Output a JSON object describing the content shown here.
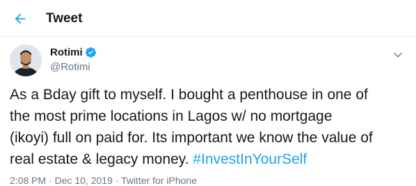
{
  "header": {
    "title": "Tweet",
    "back_icon": "arrow-left-icon"
  },
  "colors": {
    "accent": "#1da1f2",
    "text": "#14171a",
    "muted": "#657786",
    "divider": "#e6ecf0"
  },
  "tweet": {
    "author": {
      "display_name": "Rotimi",
      "handle": "@Rotimi",
      "verified_icon": "verified-badge-icon"
    },
    "menu_icon": "chevron-down-icon",
    "text": "As a Bday gift to myself. I bought a penthouse in one of\nthe most prime locations in Lagos w/ no mortgage\n(ikoyi) full on paid for. Its important we know the value of\nreal estate & legacy money. ",
    "hashtag": "#InvestInYourSelf",
    "meta": "2:08 PM · Dec 10, 2019 · Twitter for iPhone"
  }
}
